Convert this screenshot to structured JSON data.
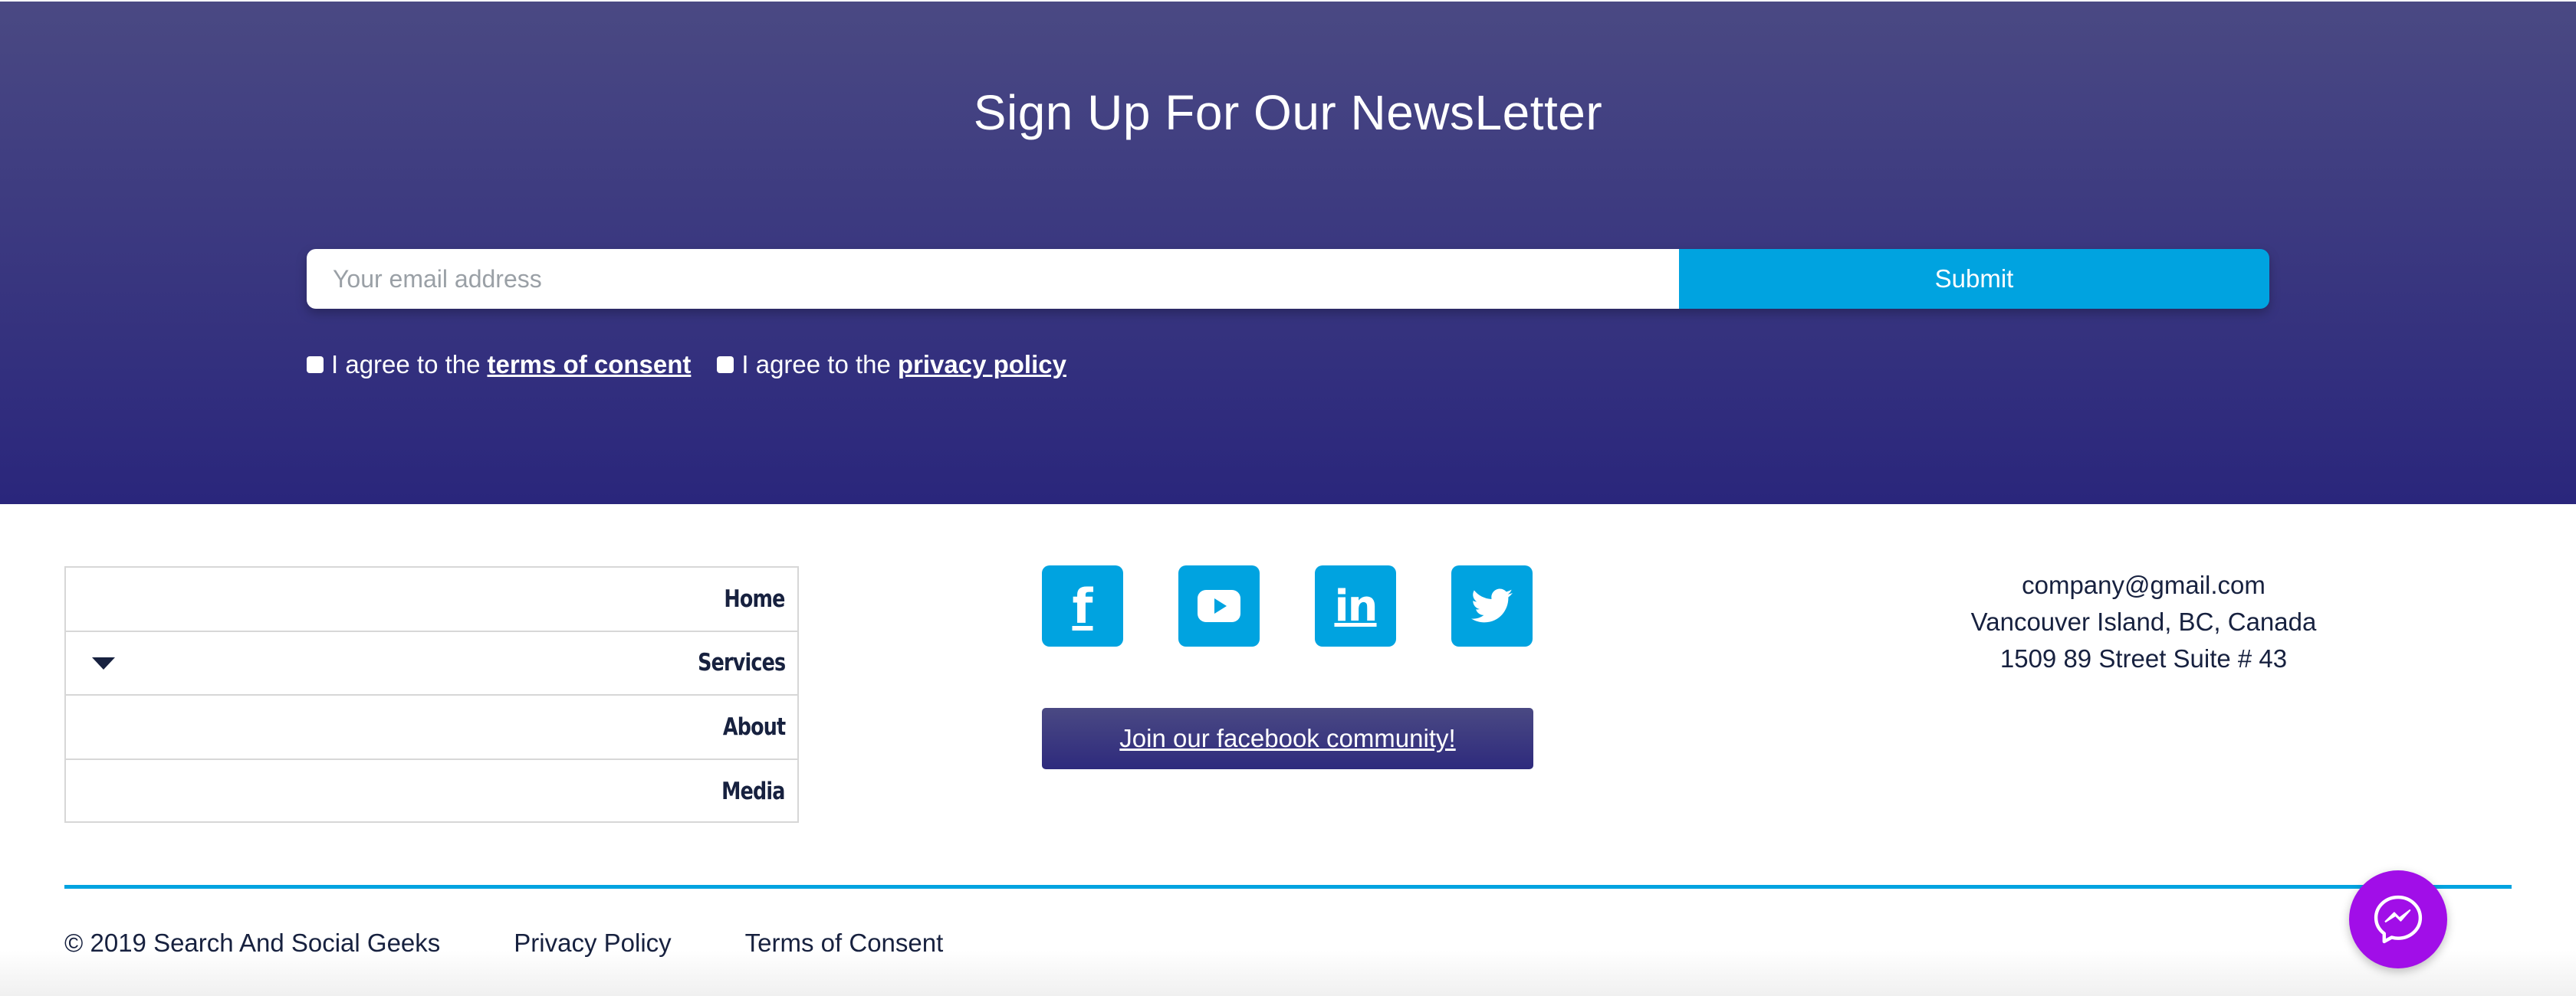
{
  "newsletter": {
    "title": "Sign Up For Our NewsLetter",
    "email_placeholder": "Your email address",
    "submit_label": "Submit",
    "consent_terms_prefix": "I agree to the",
    "consent_terms_link": "terms of consent",
    "consent_privacy_prefix": "I agree to the",
    "consent_privacy_link": "privacy policy"
  },
  "menu": {
    "items": [
      {
        "label": "Home"
      },
      {
        "label": "Services"
      },
      {
        "label": "About"
      },
      {
        "label": "Media"
      }
    ]
  },
  "social": {
    "icons": [
      "facebook-icon",
      "youtube-icon",
      "linkedin-icon",
      "twitter-icon"
    ],
    "community_label": "Join our facebook community!"
  },
  "contact": {
    "email": "company@gmail.com",
    "location": "Vancouver Island, BC, Canada",
    "address": "1509 89 Street Suite # 43"
  },
  "footer": {
    "copyright": "© 2019 Search And Social Geeks",
    "privacy_link": "Privacy Policy",
    "terms_link": "Terms of Consent"
  },
  "colors": {
    "band_top": "#4a4983",
    "band_bottom": "#2a267c",
    "accent_blue": "#00a3e0",
    "messenger_purple": "#a10ee8",
    "text_dark": "#17213f"
  }
}
